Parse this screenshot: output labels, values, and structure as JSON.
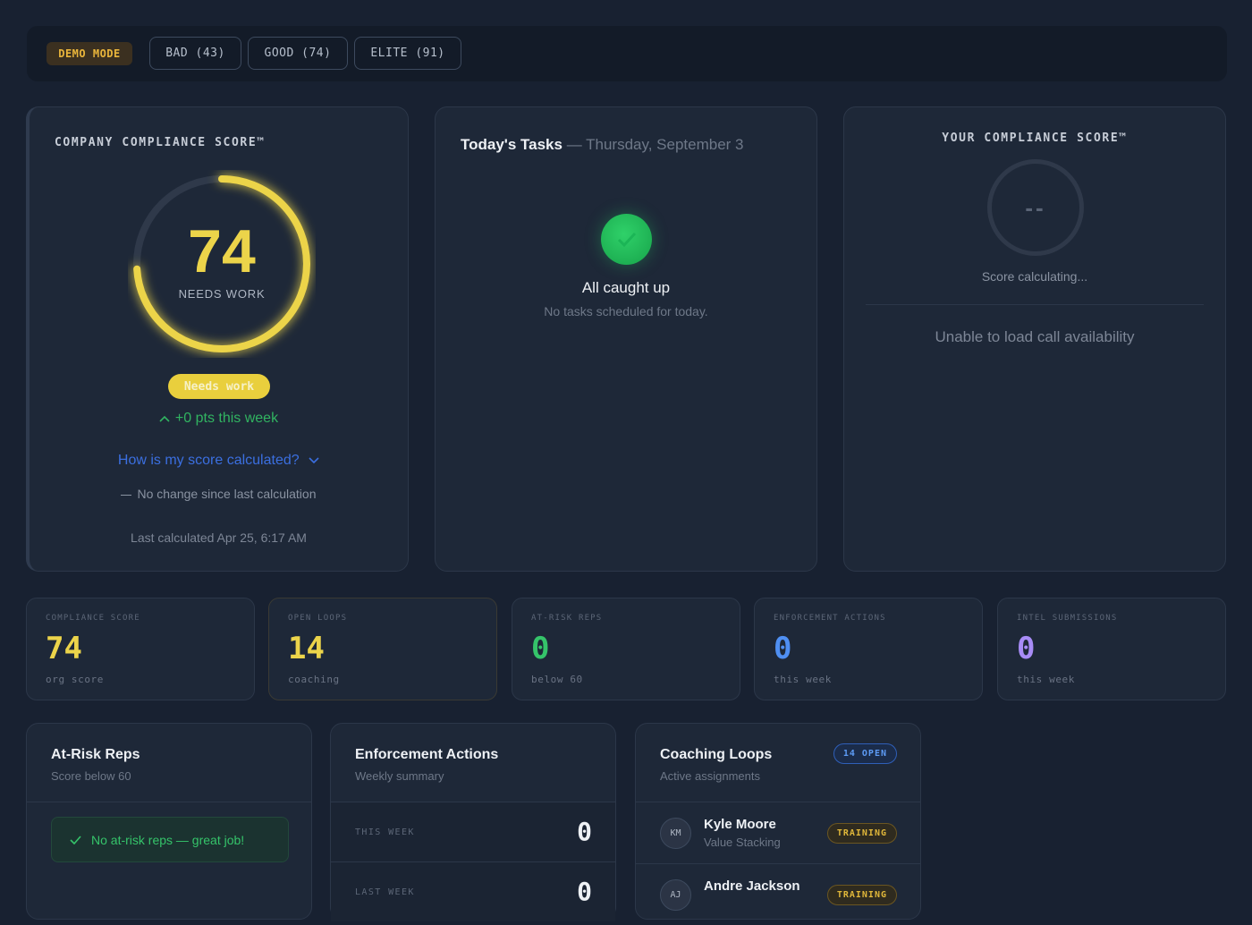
{
  "topbar": {
    "demo_label": "DEMO MODE",
    "modes": [
      "BAD (43)",
      "GOOD (74)",
      "ELITE (91)"
    ]
  },
  "company_score": {
    "title": "COMPANY COMPLIANCE SCORE™",
    "score": "74",
    "score_fraction": 0.74,
    "status": "NEEDS WORK",
    "badge": "Needs work",
    "delta": "+0 pts this week",
    "how_link": "How is my score calculated?",
    "no_change": "No change since last calculation",
    "last_calc": "Last calculated Apr 25, 6:17 AM"
  },
  "tasks": {
    "title": "Today's Tasks",
    "date": "— Thursday, September 3",
    "empty_title": "All caught up",
    "empty_sub": "No tasks scheduled for today."
  },
  "your_score": {
    "title": "YOUR COMPLIANCE SCORE™",
    "value": "--",
    "status": "Score calculating...",
    "availability": "Unable to load call availability"
  },
  "tiles": [
    {
      "label": "COMPLIANCE SCORE",
      "value": "74",
      "sub": "org score",
      "color": "#ecd44a"
    },
    {
      "label": "OPEN LOOPS",
      "value": "14",
      "sub": "coaching",
      "color": "#ecd44a"
    },
    {
      "label": "AT-RISK REPS",
      "value": "0",
      "sub": "below 60",
      "color": "#35c46a"
    },
    {
      "label": "ENFORCEMENT ACTIONS",
      "value": "0",
      "sub": "this week",
      "color": "#4f8ff2"
    },
    {
      "label": "INTEL SUBMISSIONS",
      "value": "0",
      "sub": "this week",
      "color": "#a88cf6"
    }
  ],
  "at_risk": {
    "title": "At-Risk Reps",
    "sub": "Score below 60",
    "ok_msg": "No at-risk reps — great job!"
  },
  "enforcement": {
    "title": "Enforcement Actions",
    "sub": "Weekly summary",
    "rows": [
      {
        "label": "THIS WEEK",
        "value": "0"
      },
      {
        "label": "LAST WEEK",
        "value": "0"
      }
    ]
  },
  "coaching": {
    "title": "Coaching Loops",
    "sub": "Active assignments",
    "badge": "14 OPEN",
    "reps": [
      {
        "initials": "KM",
        "name": "Kyle Moore",
        "topic": "Value Stacking",
        "tag": "TRAINING"
      },
      {
        "initials": "AJ",
        "name": "Andre Jackson",
        "topic": "",
        "tag": "TRAINING"
      }
    ]
  },
  "colors": {
    "accent_yellow": "#ecd44a",
    "success_green": "#35c46a",
    "link_blue": "#3b6fe0",
    "purple": "#a88cf6"
  }
}
